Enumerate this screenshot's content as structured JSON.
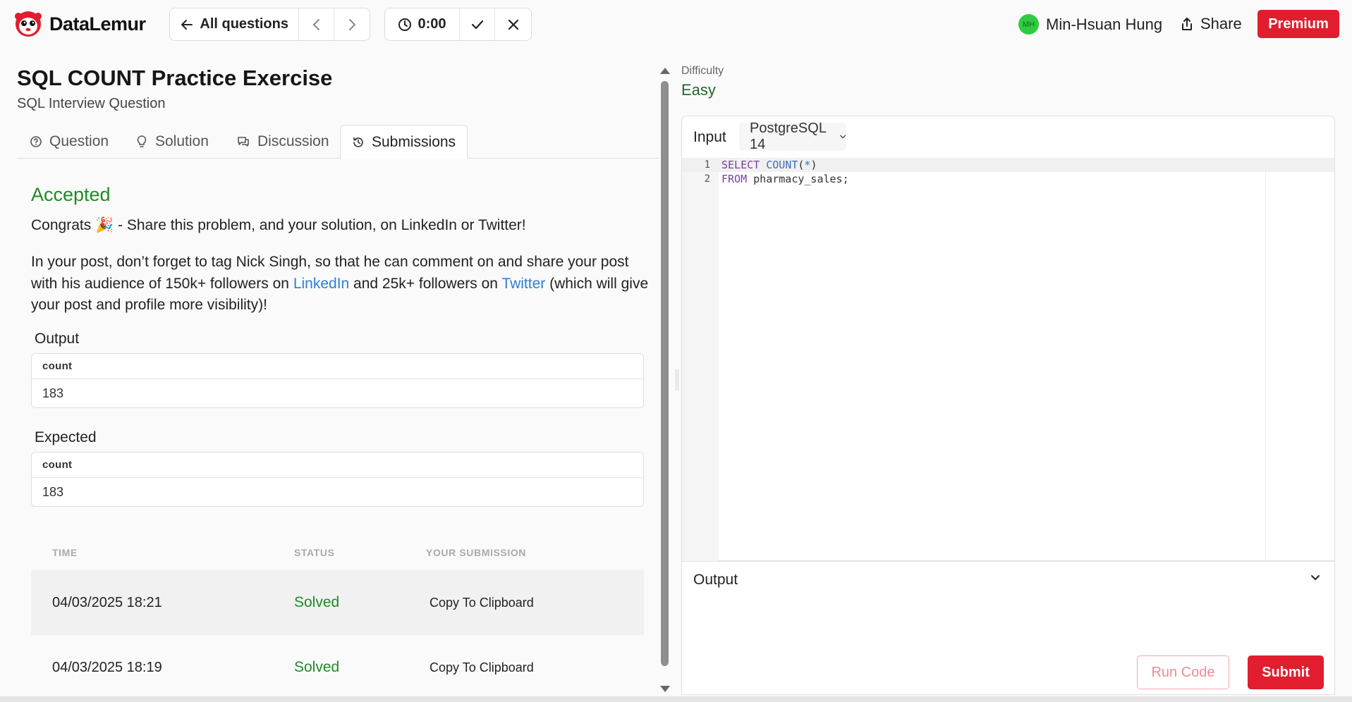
{
  "brand": {
    "name": "DataLemur"
  },
  "nav": {
    "all_questions": "All questions",
    "timer": "0:00"
  },
  "user": {
    "initials": "MH",
    "name": "Min-Hsuan Hung"
  },
  "header_actions": {
    "share": "Share",
    "premium": "Premium"
  },
  "question": {
    "title": "SQL COUNT Practice Exercise",
    "subtitle": "SQL Interview Question"
  },
  "tabs": [
    {
      "label": "Question",
      "icon": "question-circle-icon"
    },
    {
      "label": "Solution",
      "icon": "lightbulb-icon"
    },
    {
      "label": "Discussion",
      "icon": "chat-bubbles-icon"
    },
    {
      "label": "Submissions",
      "icon": "history-icon",
      "active": true
    }
  ],
  "result": {
    "status": "Accepted",
    "congrats_text": "Congrats 🎉 - Share this problem, and your solution, on LinkedIn or Twitter!",
    "post_part1": "In your post, don’t forget to tag Nick Singh, so that he can comment on and share your post with his audience of 150k+ followers on ",
    "linkedin": "LinkedIn",
    "post_part2": " and 25k+ followers on ",
    "twitter": "Twitter",
    "post_part3": " (which will give your post and profile more visibility)!",
    "output_label": "Output",
    "output_column": "count",
    "output_value": "183",
    "expected_label": "Expected",
    "expected_column": "count",
    "expected_value": "183"
  },
  "submissions": {
    "headers": {
      "time": "TIME",
      "status": "STATUS",
      "submission": "YOUR SUBMISSION"
    },
    "rows": [
      {
        "time": "04/03/2025 18:21",
        "status": "Solved",
        "action": "Copy To Clipboard"
      },
      {
        "time": "04/03/2025 18:19",
        "status": "Solved",
        "action": "Copy To Clipboard"
      }
    ]
  },
  "difficulty": {
    "label": "Difficulty",
    "value": "Easy"
  },
  "editor": {
    "input_label": "Input",
    "language": "PostgreSQL 14",
    "lines": [
      {
        "num": "1",
        "kw1": "SELECT",
        "sp": " ",
        "fn": "COUNT",
        "open": "(",
        "star": "*",
        "close": ")"
      },
      {
        "num": "2",
        "kw1": "FROM",
        "rest": " pharmacy_sales;"
      }
    ]
  },
  "output_panel": {
    "label": "Output",
    "run_code": "Run Code",
    "submit": "Submit"
  },
  "colors": {
    "brand_red": "#e11d2e",
    "success_green": "#1f8b24",
    "link_blue": "#2f7fd3"
  }
}
